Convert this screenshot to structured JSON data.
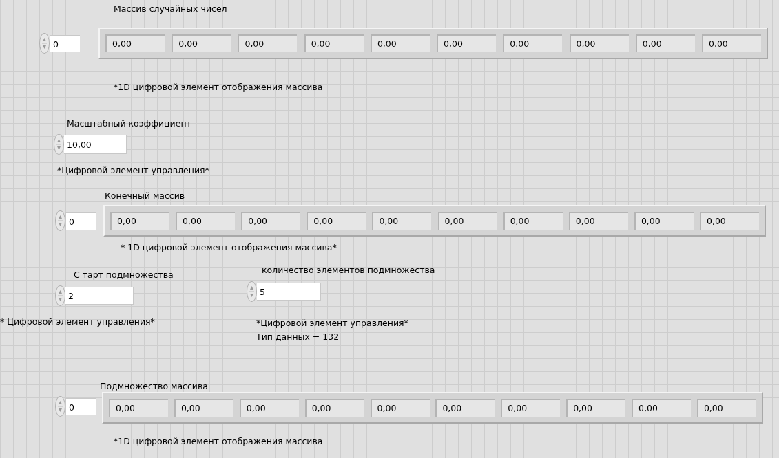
{
  "arrays": [
    {
      "label": "Массив случайных чисел",
      "index": "0",
      "values": [
        "0,00",
        "0,00",
        "0,00",
        "0,00",
        "0,00",
        "0,00",
        "0,00",
        "0,00",
        "0,00",
        "0,00"
      ],
      "caption": "*1D цифровой элемент отображения массива"
    },
    {
      "label": "Конечный массив",
      "index": "0",
      "values": [
        "0,00",
        "0,00",
        "0,00",
        "0,00",
        "0,00",
        "0,00",
        "0,00",
        "0,00",
        "0,00",
        "0,00"
      ],
      "caption": "* 1D цифровой элемент отображения массива*"
    },
    {
      "label": "Подмножество массива",
      "index": "0",
      "values": [
        "0,00",
        "0,00",
        "0,00",
        "0,00",
        "0,00",
        "0,00",
        "0,00",
        "0,00",
        "0,00",
        "0,00"
      ],
      "caption": "*1D цифровой элемент отображения массива"
    }
  ],
  "numerics": [
    {
      "label": "Масштабный коэффициент",
      "value": "10,00",
      "caption": [
        "*Цифровой элемент управления*"
      ]
    },
    {
      "label": "С тарт подмножества",
      "value": "2",
      "caption": [
        "* Цифровой элемент управления*"
      ]
    },
    {
      "label": "количество элементов подмножества",
      "value": "5",
      "caption": [
        "*Цифровой элемент управления*",
        "Тип данных = 132"
      ]
    }
  ]
}
